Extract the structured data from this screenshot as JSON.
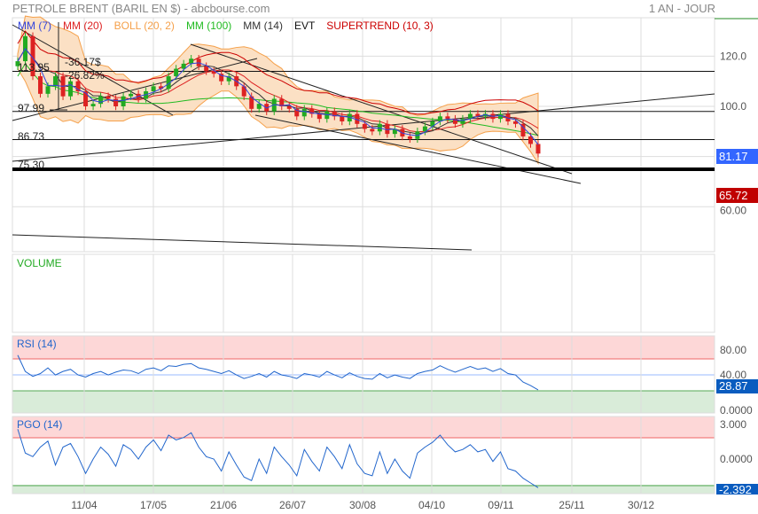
{
  "header": {
    "title": "PETROLE BRENT (BARIL EN $) - abcbourse.com",
    "period": "1 AN - JOUR"
  },
  "legend": [
    {
      "label": "MM (7)",
      "color": "#3344dd"
    },
    {
      "label": "MM (20)",
      "color": "#dd2222"
    },
    {
      "label": "BOLL (20, 2)",
      "color": "#f5a04a"
    },
    {
      "label": "MM (100)",
      "color": "#22bb22"
    },
    {
      "label": "MM (14)",
      "color": "#333333"
    },
    {
      "label": "EVT",
      "color": "#111111"
    },
    {
      "label": "SUPERTREND (10, 3)",
      "color": "#cc0000"
    }
  ],
  "annotations": {
    "delta_abs": "-36.17$",
    "delta_pct": "-26.82%",
    "levels": [
      "113.95",
      "97.99",
      "86.73",
      "75.30"
    ]
  },
  "badges": {
    "last": "81.17",
    "last_color": "#3366ff",
    "supertrend": "65.72",
    "supertrend_color": "#c00000",
    "rsi": "28.87",
    "rsi_color": "#0a5cbf",
    "pgo": "-2.392",
    "pgo_color": "#0a5cbf"
  },
  "panels": {
    "volume": "VOLUME",
    "rsi": "RSI (14)",
    "pgo": "PGO (14)"
  },
  "chart_data": {
    "type": "candlestick",
    "title": "PETROLE BRENT (BARIL EN $)",
    "x_ticks": [
      "11/04",
      "17/05",
      "21/06",
      "26/07",
      "30/08",
      "04/10",
      "09/11",
      "25/11",
      "30/12"
    ],
    "y_ticks": [
      "120.0",
      "100.0",
      "60.00"
    ],
    "ylim": [
      45,
      135
    ],
    "levels": [
      113.95,
      97.99,
      86.73,
      75.3
    ],
    "close": [
      118,
      128,
      112,
      105,
      108,
      112,
      104,
      110,
      106,
      100,
      101,
      104,
      103,
      100,
      104,
      105,
      103,
      106,
      108,
      107,
      112,
      115,
      117,
      119,
      116,
      114,
      113,
      110,
      112,
      108,
      104,
      99,
      101,
      98,
      103,
      100,
      99,
      96,
      99,
      97,
      95,
      98,
      96,
      94,
      97,
      93,
      91,
      90,
      93,
      89,
      91,
      88,
      87,
      90,
      92,
      94,
      96,
      95,
      93,
      95,
      97,
      96,
      97,
      95,
      97,
      94,
      93,
      88,
      85,
      81.17
    ],
    "rsi": {
      "ticks": [
        "80.00",
        "40.00",
        "0.0000"
      ],
      "ylim": [
        0,
        100
      ],
      "zones": [
        70,
        30
      ],
      "values": [
        78,
        55,
        48,
        52,
        60,
        50,
        55,
        58,
        50,
        47,
        52,
        55,
        50,
        54,
        57,
        56,
        52,
        58,
        60,
        56,
        63,
        62,
        65,
        66,
        60,
        58,
        55,
        52,
        56,
        50,
        45,
        48,
        52,
        47,
        55,
        50,
        48,
        45,
        52,
        50,
        47,
        55,
        50,
        46,
        53,
        48,
        45,
        44,
        52,
        46,
        50,
        47,
        45,
        52,
        55,
        57,
        63,
        58,
        54,
        58,
        62,
        58,
        60,
        55,
        59,
        52,
        50,
        40,
        35,
        28.87
      ]
    },
    "pgo": {
      "ticks": [
        "3.000",
        "0.0000"
      ],
      "ylim": [
        -2.8,
        3.5
      ],
      "zones": [
        2,
        -2
      ],
      "values": [
        2.5,
        0.5,
        0.2,
        1.0,
        1.5,
        -0.5,
        1.0,
        1.3,
        0.2,
        -1.2,
        0.0,
        1.0,
        0.4,
        -0.6,
        1.2,
        0.8,
        0.0,
        1.0,
        1.6,
        0.7,
        2.0,
        1.6,
        1.8,
        2.2,
        1.0,
        0.2,
        0.0,
        -1.0,
        0.6,
        -0.5,
        -1.5,
        -1.8,
        0.0,
        -1.2,
        1.0,
        0.2,
        -0.5,
        -1.4,
        0.8,
        -0.2,
        -1.0,
        1.0,
        0.2,
        -0.8,
        1.2,
        -0.4,
        -1.2,
        -1.4,
        0.6,
        -1.2,
        0.0,
        -1.0,
        -1.6,
        0.5,
        1.0,
        1.4,
        2.0,
        1.2,
        0.6,
        0.8,
        1.2,
        0.6,
        0.8,
        -0.2,
        0.6,
        -0.8,
        -1.0,
        -1.6,
        -2.0,
        -2.392
      ]
    }
  }
}
